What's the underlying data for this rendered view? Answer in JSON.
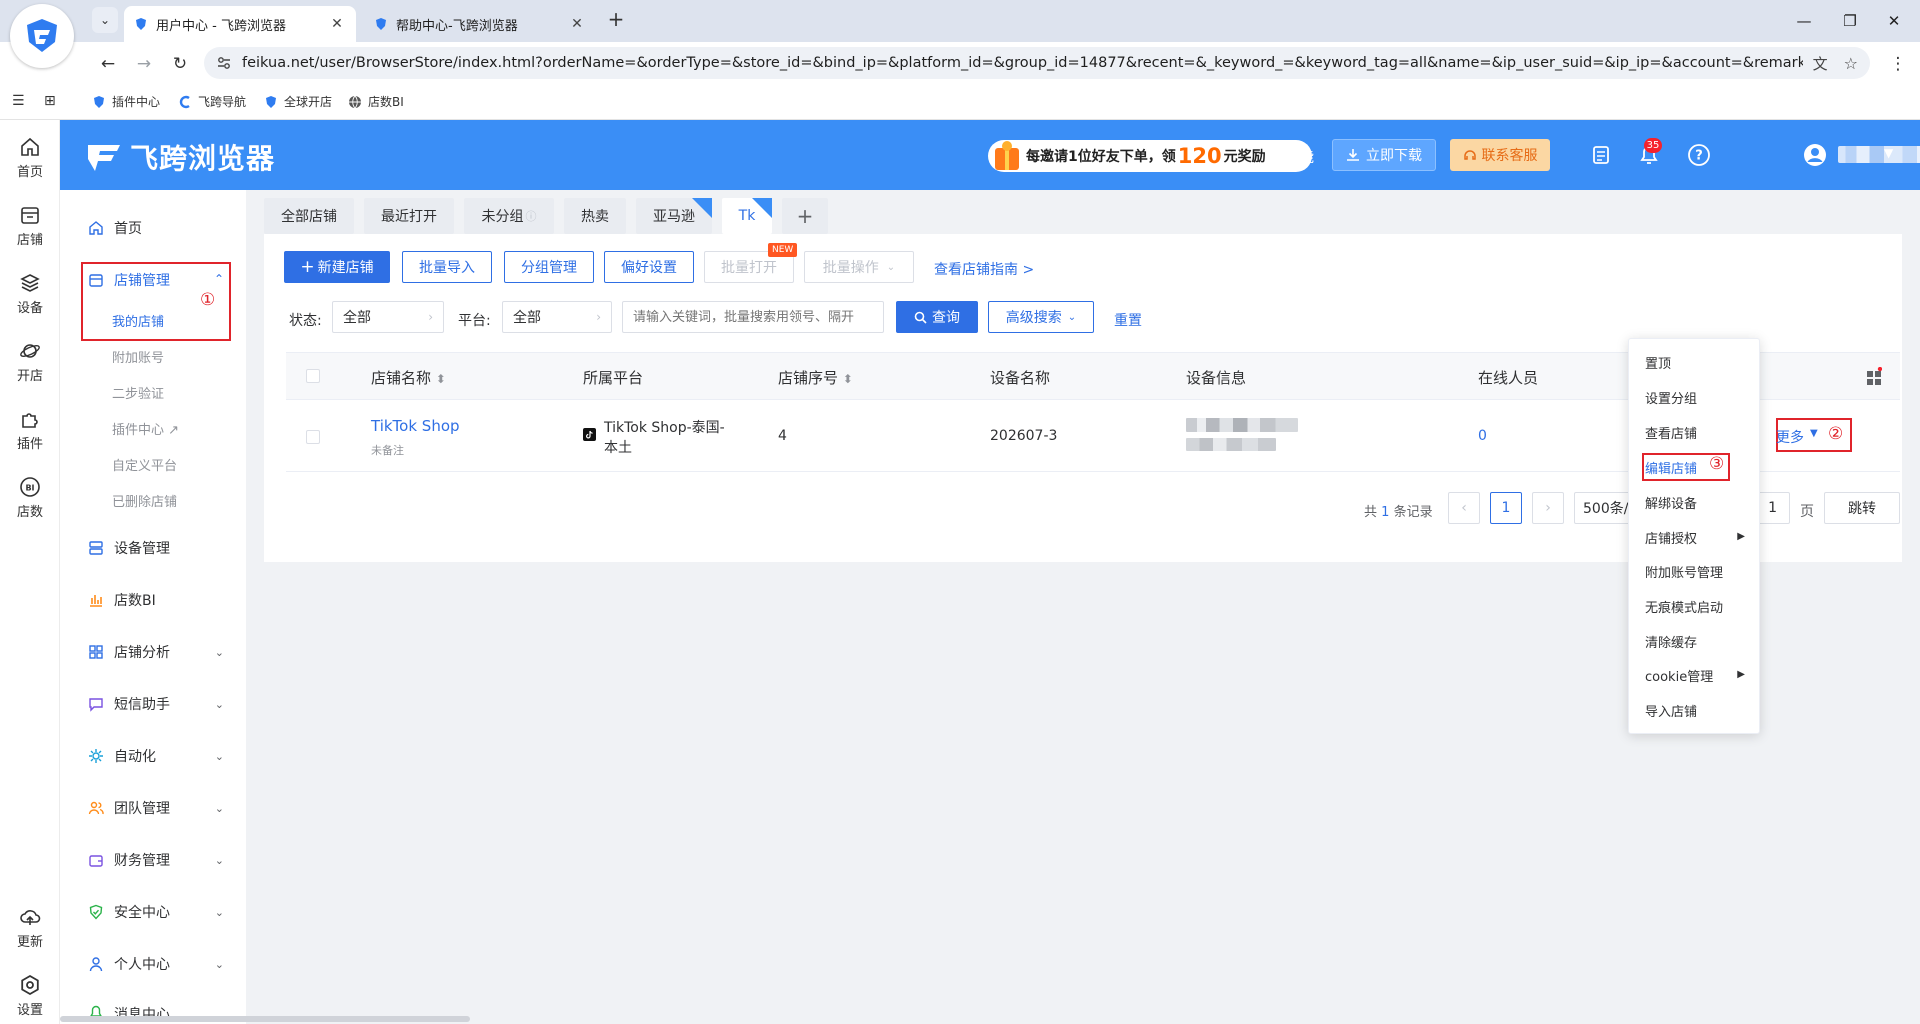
{
  "browser": {
    "tabs": [
      {
        "title": "用户中心 - 飞跨浏览器",
        "active": true
      },
      {
        "title": "帮助中心-飞跨浏览器",
        "active": false
      }
    ],
    "url": "feikua.net/user/BrowserStore/index.html?orderName=&orderType=&store_id=&bind_ip=&platform_id=&group_id=14877&recent=&_keyword_=&keyword_tag=all&name=&ip_user_suid=&ip_ip=&account=&remark=&page=1",
    "bookmarks": [
      "插件中心",
      "飞跨导航",
      "全球开店",
      "店数BI"
    ]
  },
  "rail": {
    "items": [
      "首页",
      "店铺",
      "设备",
      "开店",
      "插件",
      "店数"
    ],
    "bottom": [
      "更新",
      "设置"
    ]
  },
  "header": {
    "brand": "飞跨浏览器",
    "promo_prefix": "每邀请1位好友下单，领",
    "promo_amount": "120",
    "promo_suffix": "元奖励",
    "new_features": "新功能",
    "download": "立即下载",
    "customer_service": "联系客服",
    "notification_count": "35"
  },
  "menu": {
    "home": "首页",
    "store_mgmt": "店铺管理",
    "store_sub": [
      "我的店铺",
      "附加账号",
      "二步验证",
      "插件中心",
      "自定义平台",
      "已删除店铺"
    ],
    "device_mgmt": "设备管理",
    "store_bi": "店数BI",
    "groups": [
      "店铺分析",
      "短信助手",
      "自动化",
      "团队管理",
      "财务管理",
      "安全中心",
      "个人中心",
      "消息中心"
    ]
  },
  "annotations": [
    "①",
    "②",
    "③"
  ],
  "view_tabs": [
    "全部店铺",
    "最近打开",
    "未分组",
    "热卖",
    "亚马逊",
    "Tk"
  ],
  "toolbar": {
    "new_store": "新建店铺",
    "batch_import": "批量导入",
    "group_mgmt": "分组管理",
    "preferences": "偏好设置",
    "batch_open": "批量打开",
    "new_badge": "NEW",
    "batch_ops": "批量操作",
    "guide": "查看店铺指南 >"
  },
  "filters": {
    "status_label": "状态:",
    "status_value": "全部",
    "platform_label": "平台:",
    "platform_value": "全部",
    "keyword_placeholder": "请输入关键词，批量搜索用领号、隔开",
    "query": "查询",
    "advanced": "高级搜索",
    "reset": "重置"
  },
  "table": {
    "columns": [
      "店铺名称",
      "所属平台",
      "店铺序号",
      "设备名称",
      "设备信息",
      "在线人员"
    ],
    "rows": [
      {
        "store_name": "TikTok Shop",
        "remark": "未备注",
        "platform_line1": "TikTok Shop-泰国-",
        "platform_line2": "本土",
        "seq": "4",
        "device_name": "202607-3",
        "online": "0",
        "more": "更多"
      }
    ]
  },
  "pager": {
    "total_prefix": "共",
    "total": "1",
    "total_suffix": "条记录",
    "current": "1",
    "page_size": "500条/",
    "goto_value": "1",
    "page_unit": "页",
    "jump": "跳转"
  },
  "dropdown": {
    "items": [
      "置顶",
      "设置分组",
      "查看店铺",
      "编辑店铺",
      "解绑设备",
      "店铺授权",
      "附加账号管理",
      "无痕模式启动",
      "清除缓存",
      "cookie管理",
      "导入店铺"
    ]
  },
  "colors": {
    "accent": "#3a8ef6",
    "primary": "#2f6fe4",
    "annotation_red": "#e0242b"
  }
}
